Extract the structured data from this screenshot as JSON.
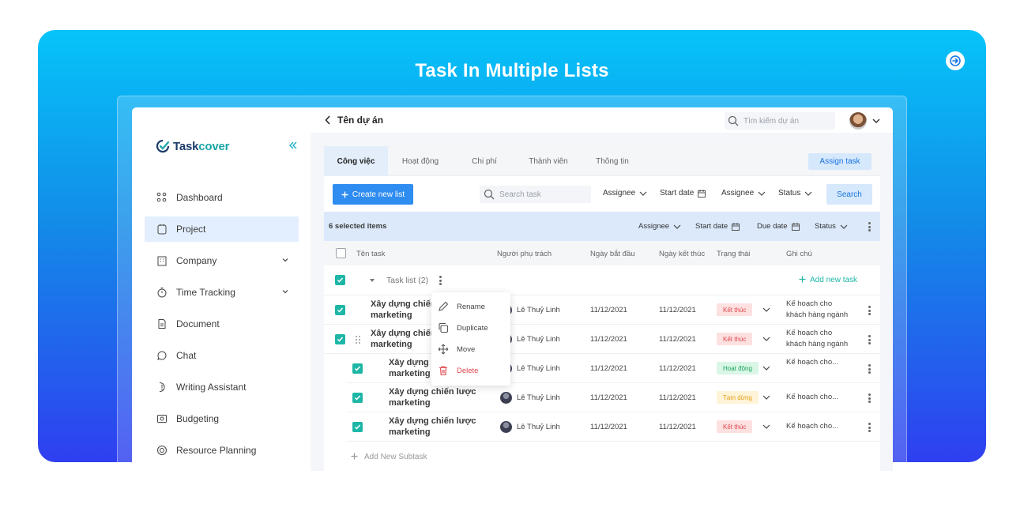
{
  "hero": {
    "title": "Task In Multiple Lists"
  },
  "brand": {
    "logo_text_a": "Task",
    "logo_text_b": "cover"
  },
  "sidebar": {
    "items": [
      {
        "label": "Dashboard",
        "icon": "dashboard-icon"
      },
      {
        "label": "Project",
        "icon": "project-icon",
        "active": true
      },
      {
        "label": "Company",
        "icon": "company-icon",
        "expandable": true
      },
      {
        "label": "Time Tracking",
        "icon": "stopwatch-icon",
        "expandable": true
      },
      {
        "label": "Document",
        "icon": "document-icon"
      },
      {
        "label": "Chat",
        "icon": "chat-icon"
      },
      {
        "label": "Writing Assistant",
        "icon": "writing-icon"
      },
      {
        "label": "Budgeting",
        "icon": "budget-icon"
      },
      {
        "label": "Resource Planning",
        "icon": "resource-icon"
      }
    ]
  },
  "topbar": {
    "project_title": "Tên dự án",
    "search_placeholder": "Tìm kiếm dự án"
  },
  "tabs": [
    "Công việc",
    "Hoạt động",
    "Chi phí",
    "Thành viên",
    "Thông tin"
  ],
  "assign_task": "Assign task",
  "toolbar": {
    "create_list": "Create new list",
    "search_placeholder": "Search task",
    "filters": [
      "Assignee",
      "Start date",
      "Assignee",
      "Status"
    ],
    "search_button": "Search"
  },
  "selection": {
    "count_label": "6 selected items",
    "filters": [
      "Assignee",
      "Start date",
      "Due date",
      "Status"
    ]
  },
  "columns": [
    "Tên task",
    "Người phụ trách",
    "Ngày bắt đầu",
    "Ngày kết thúc",
    "Trạng thái",
    "Ghi chú"
  ],
  "group": {
    "name": "Task list (2)",
    "add_task": "Add new task"
  },
  "rows": [
    {
      "name_l1": "Xây dựng chiến",
      "name_l2": "marketing",
      "assignee": "Lê Thuỷ Linh",
      "start": "11/12/2021",
      "end": "11/12/2021",
      "status": "Kết thúc",
      "note_l1": "Kế hoạch cho",
      "note_l2": "khách hàng ngành"
    },
    {
      "name_l1": "Xây dựng chiến",
      "name_l2": "marketing",
      "assignee": "Lê Thuỷ Linh",
      "start": "11/12/2021",
      "end": "11/12/2021",
      "status": "Kết thúc",
      "note_l1": "Kế hoạch cho",
      "note_l2": "khách hàng ngành"
    },
    {
      "name_l1": "Xây dựng c",
      "name_l2": "marketing",
      "assignee": "Lê Thuỷ Linh",
      "start": "11/12/2021",
      "end": "11/12/2021",
      "status": "Hoạt động",
      "note_l1": "Kế hoạch cho...",
      "note_l2": ""
    },
    {
      "name_l1": "Xây dựng chiến lược",
      "name_l2": "marketing",
      "assignee": "Lê Thuỷ Linh",
      "start": "11/12/2021",
      "end": "11/12/2021",
      "status": "Tạm dừng",
      "note_l1": "Kế hoạch cho...",
      "note_l2": ""
    },
    {
      "name_l1": "Xây dựng chiến lược",
      "name_l2": "marketing",
      "assignee": "Lê Thuỷ Linh",
      "start": "11/12/2021",
      "end": "11/12/2021",
      "status": "Kết thúc",
      "note_l1": "Kế hoạch cho...",
      "note_l2": ""
    }
  ],
  "add_subtask": "Add New Subtask",
  "context_menu": [
    "Rename",
    "Duplicate",
    "Move",
    "Delete"
  ],
  "colors": {
    "accent": "#2f8cf0",
    "teal": "#1eb6a6",
    "danger": "#e0474d"
  }
}
